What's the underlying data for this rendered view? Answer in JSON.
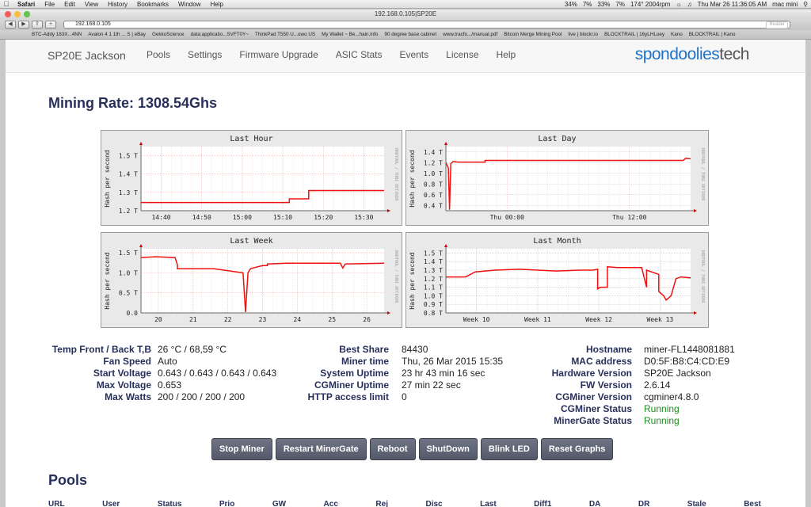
{
  "os_menubar": {
    "app": "Safari",
    "items": [
      "File",
      "Edit",
      "View",
      "History",
      "Bookmarks",
      "Window",
      "Help"
    ],
    "status": [
      "34%",
      "7%",
      "33%",
      "7%",
      "174° 2004rpm",
      "Thu Mar 26  11:36:05 AM",
      "mac mini"
    ]
  },
  "browser": {
    "window_title": "192.168.0.105|SP20E",
    "url": "192.168.0.105",
    "reader_label": "Reader",
    "bookmarks": [
      "BTC-Addy 183X...4NN",
      "Avalon 4 1 1th ... S | eBay",
      "GekkoScience",
      "data:applicatio...SVFT0Y~",
      "ThinkPad T550 U...owo US",
      "My Wallet ~ Be...hain.info",
      "90 degree base cabinet",
      "www.tracfo.../manual.pdf",
      "Bitcoin Merge Mining Pool",
      "live | blockr.io",
      "BLOCKTRAIL | 16yLHLoey",
      "Kano",
      "BLOCKTRAIL | Kano"
    ]
  },
  "nav": {
    "brand": "SP20E Jackson",
    "links": [
      "Pools",
      "Settings",
      "Firmware Upgrade",
      "ASIC Stats",
      "Events",
      "License",
      "Help"
    ],
    "logo_part1": "spondoolies",
    "logo_part2": "tech"
  },
  "mining_rate": "Mining Rate: 1308.54Ghs",
  "graphs": [
    {
      "title": "Last Hour",
      "ylabel": "Hash per second",
      "side": "RRDTOOL / TOBI OETIKER",
      "yticks": [
        "1.2 T",
        "1.3 T",
        "1.4 T",
        "1.5 T"
      ],
      "xticks": [
        "14:40",
        "14:50",
        "15:00",
        "15:10",
        "15:20",
        "15:30"
      ]
    },
    {
      "title": "Last Day",
      "ylabel": "Hash per second",
      "side": "RRDTOOL / TOBI OETIKER",
      "yticks": [
        "0.4 T",
        "0.6 T",
        "0.8 T",
        "1.0 T",
        "1.2 T",
        "1.4 T"
      ],
      "xticks": [
        "Thu 00:00",
        "Thu 12:00"
      ]
    },
    {
      "title": "Last Week",
      "ylabel": "Hash per second",
      "side": "RRDTOOL / TOBI OETIKER",
      "yticks": [
        "0.0",
        "0.5 T",
        "1.0 T",
        "1.5 T"
      ],
      "xticks": [
        "20",
        "21",
        "22",
        "23",
        "24",
        "25",
        "26"
      ]
    },
    {
      "title": "Last Month",
      "ylabel": "Hash per second",
      "side": "RRDTOOL / TOBI OETIKER",
      "yticks": [
        "0.8 T",
        "0.9 T",
        "1.0 T",
        "1.1 T",
        "1.2 T",
        "1.3 T",
        "1.4 T",
        "1.5 T"
      ],
      "xticks": [
        "Week 10",
        "Week 11",
        "Week 12",
        "Week 13"
      ]
    }
  ],
  "stats": {
    "col1": [
      {
        "label": "Temp Front / Back T,B",
        "value": "26 °C / 68,59 °C"
      },
      {
        "label": "Fan Speed",
        "value": "Auto"
      },
      {
        "label": "Start Voltage",
        "value": "0.643 / 0.643 / 0.643 / 0.643"
      },
      {
        "label": "Max Voltage",
        "value": "0.653"
      },
      {
        "label": "Max Watts",
        "value": "200 / 200 / 200 / 200"
      }
    ],
    "col2": [
      {
        "label": "Best Share",
        "value": "84430"
      },
      {
        "label": "Miner time",
        "value": "Thu, 26 Mar 2015 15:35"
      },
      {
        "label": "System Uptime",
        "value": "23 hr 43 min 16 sec"
      },
      {
        "label": "CGMiner Uptime",
        "value": "27 min 22 sec"
      },
      {
        "label": "HTTP access limit",
        "value": "0"
      }
    ],
    "col3": [
      {
        "label": "Hostname",
        "value": "miner-FL1448081881"
      },
      {
        "label": "MAC address",
        "value": "D0:5F:B8:C4:CD:E9"
      },
      {
        "label": "Hardware Version",
        "value": "SP20E Jackson"
      },
      {
        "label": "FW Version",
        "value": "2.6.14"
      },
      {
        "label": "CGMiner Version",
        "value": "cgminer4.8.0"
      },
      {
        "label": "CGMiner Status",
        "value": "Running"
      },
      {
        "label": "MinerGate Status",
        "value": "Running"
      }
    ]
  },
  "buttons": [
    "Stop Miner",
    "Restart MinerGate",
    "Reboot",
    "ShutDown",
    "Blink LED",
    "Reset Graphs"
  ],
  "pools": {
    "title": "Pools",
    "columns": [
      "URL",
      "User",
      "Status",
      "Prio",
      "GW",
      "Acc",
      "Rej",
      "Disc",
      "Last",
      "Diff1",
      "DA",
      "DR",
      "Stale",
      "Best"
    ]
  },
  "colors": {
    "line": "#ee1111",
    "heading": "#27305a",
    "logo_blue": "#1e73c9",
    "running": "#1f8c1f",
    "button": "#5f6374"
  },
  "chart_data": [
    {
      "type": "line",
      "title": "Last Hour",
      "ylabel": "Hash per second",
      "xticks": [
        "14:40",
        "14:50",
        "15:00",
        "15:10",
        "15:20",
        "15:30"
      ],
      "ylim": [
        1.2,
        1.55
      ],
      "series": [
        {
          "x": [
            0,
            0.61,
            0.61,
            0.69,
            0.69,
            1.0
          ],
          "values": [
            1.245,
            1.245,
            1.265,
            1.265,
            1.31,
            1.31
          ]
        }
      ]
    },
    {
      "type": "line",
      "title": "Last Day",
      "ylabel": "Hash per second",
      "xticks": [
        "Thu 00:00",
        "Thu 12:00"
      ],
      "ylim": [
        0.3,
        1.5
      ],
      "series": [
        {
          "x": [
            0,
            0.01,
            0.015,
            0.02,
            0.03,
            0.05,
            0.16,
            0.16,
            0.97,
            0.98,
            1.0
          ],
          "values": [
            1.2,
            1.1,
            0.32,
            1.18,
            1.22,
            1.21,
            1.21,
            1.24,
            1.24,
            1.28,
            1.27
          ]
        }
      ]
    },
    {
      "type": "line",
      "title": "Last Week",
      "ylabel": "Hash per second",
      "xticks": [
        "20",
        "21",
        "22",
        "23",
        "24",
        "25",
        "26"
      ],
      "ylim": [
        0,
        1.6
      ],
      "series": [
        {
          "x": [
            0,
            0.06,
            0.14,
            0.15,
            0.15,
            0.3,
            0.42,
            0.43,
            0.44,
            0.45,
            0.46,
            0.5,
            0.52,
            0.52,
            0.6,
            0.82,
            0.83,
            0.84,
            1.0
          ],
          "values": [
            1.38,
            1.4,
            1.38,
            1.2,
            1.1,
            1.1,
            1.0,
            0.02,
            1.0,
            1.1,
            1.12,
            1.18,
            1.18,
            1.22,
            1.24,
            1.24,
            1.12,
            1.22,
            1.24
          ]
        }
      ]
    },
    {
      "type": "line",
      "title": "Last Month",
      "ylabel": "Hash per second",
      "xticks": [
        "Week 10",
        "Week 11",
        "Week 12",
        "Week 13"
      ],
      "ylim": [
        0.8,
        1.55
      ],
      "series": [
        {
          "x": [
            0,
            0.08,
            0.1,
            0.12,
            0.2,
            0.3,
            0.45,
            0.55,
            0.6,
            0.62,
            0.62,
            0.63,
            0.66,
            0.66,
            0.7,
            0.8,
            0.82,
            0.82,
            0.87,
            0.87,
            0.89,
            0.9,
            0.92,
            0.94,
            0.96,
            1.0
          ],
          "values": [
            1.22,
            1.22,
            1.25,
            1.28,
            1.3,
            1.31,
            1.29,
            1.3,
            1.3,
            1.31,
            1.08,
            1.1,
            1.1,
            1.34,
            1.33,
            1.33,
            1.1,
            1.3,
            1.25,
            1.05,
            1.0,
            0.95,
            1.0,
            1.2,
            1.22,
            1.21
          ]
        }
      ]
    }
  ]
}
